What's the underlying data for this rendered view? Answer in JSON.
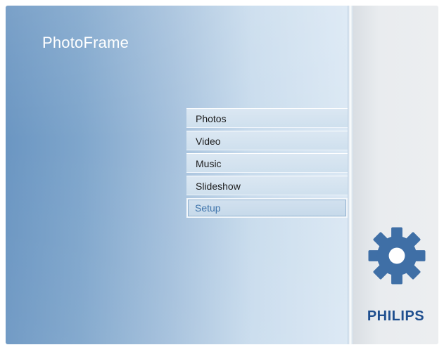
{
  "app": {
    "title": "PhotoFrame"
  },
  "menu": {
    "items": [
      {
        "label": "Photos"
      },
      {
        "label": "Video"
      },
      {
        "label": "Music"
      },
      {
        "label": "Slideshow"
      },
      {
        "label": "Setup"
      }
    ],
    "selected": "Setup"
  },
  "sidebar": {
    "icon": "gear-icon",
    "brand": "PHILIPS"
  },
  "colors": {
    "title": "#ffffff",
    "brand": "#1f4f8f",
    "gear": "#3f6fa6",
    "selected_text": "#3f74ab"
  }
}
